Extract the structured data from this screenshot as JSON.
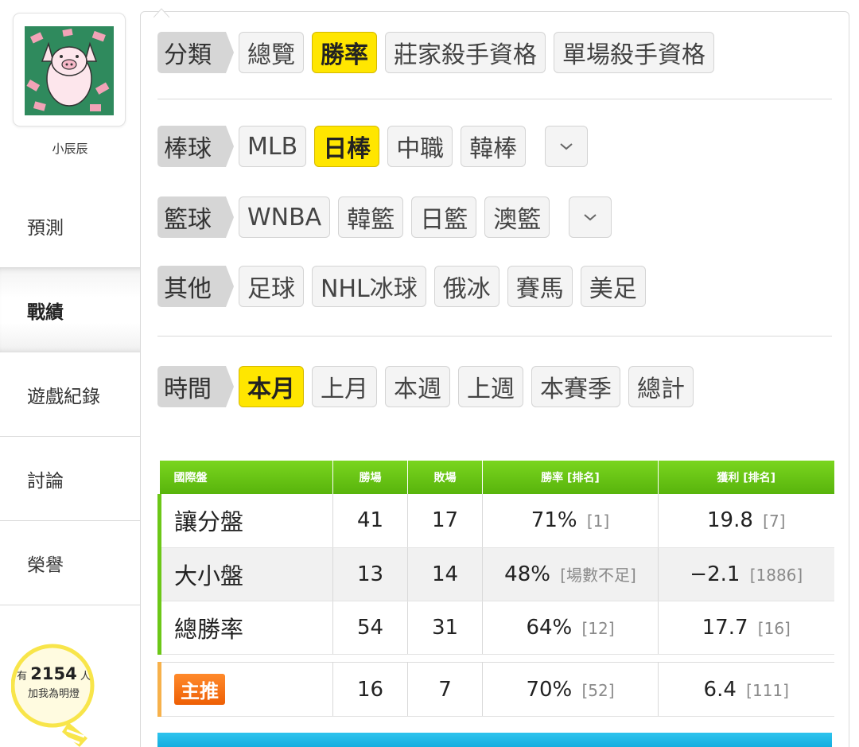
{
  "sidebar": {
    "username": "小辰辰",
    "nav": [
      {
        "label": "預測"
      },
      {
        "label": "戰績"
      },
      {
        "label": "遊戲紀錄"
      },
      {
        "label": "討論"
      },
      {
        "label": "榮譽"
      }
    ],
    "light": {
      "prefix": "有",
      "count": "2154",
      "suffix": "人",
      "cta": "加我為明燈"
    }
  },
  "filters": {
    "category": {
      "label": "分類",
      "chips": [
        "總覽",
        "勝率",
        "莊家殺手資格",
        "單場殺手資格"
      ],
      "selected": "勝率"
    },
    "baseball": {
      "label": "棒球",
      "chips": [
        "MLB",
        "日棒",
        "中職",
        "韓棒"
      ],
      "selected": "日棒"
    },
    "basketball": {
      "label": "籃球",
      "chips": [
        "WNBA",
        "韓籃",
        "日籃",
        "澳籃"
      ]
    },
    "other": {
      "label": "其他",
      "chips": [
        "足球",
        "NHL冰球",
        "俄冰",
        "賽馬",
        "美足"
      ]
    },
    "time": {
      "label": "時間",
      "chips": [
        "本月",
        "上月",
        "本週",
        "上週",
        "本賽季",
        "總計"
      ],
      "selected": "本月"
    }
  },
  "stats_table": {
    "headers": [
      "國際盤",
      "勝場",
      "敗場",
      "勝率 [排名]",
      "獲利 [排名]"
    ],
    "rows": [
      {
        "name": "讓分盤",
        "wins": "41",
        "losses": "17",
        "rate": "71%",
        "rate_rank": "[1]",
        "profit": "19.8",
        "profit_rank": "[7]"
      },
      {
        "name": "大小盤",
        "wins": "13",
        "losses": "14",
        "rate": "48%",
        "rate_rank": "[場數不足]",
        "profit": "−2.1",
        "profit_rank": "[1886]"
      },
      {
        "name": "總勝率",
        "wins": "54",
        "losses": "31",
        "rate": "64%",
        "rate_rank": "[12]",
        "profit": "17.7",
        "profit_rank": "[16]"
      }
    ],
    "main_pick": {
      "badge": "主推",
      "wins": "16",
      "losses": "7",
      "rate": "70%",
      "rate_rank": "[52]",
      "profit": "6.4",
      "profit_rank": "[111]"
    }
  },
  "colors": {
    "selected_chip": "#ffe600",
    "table_header": "#66c414",
    "next_header": "#1fb8e6",
    "badge": "#f26d12"
  },
  "icons": {
    "dropdown": "chevron-down-icon"
  }
}
